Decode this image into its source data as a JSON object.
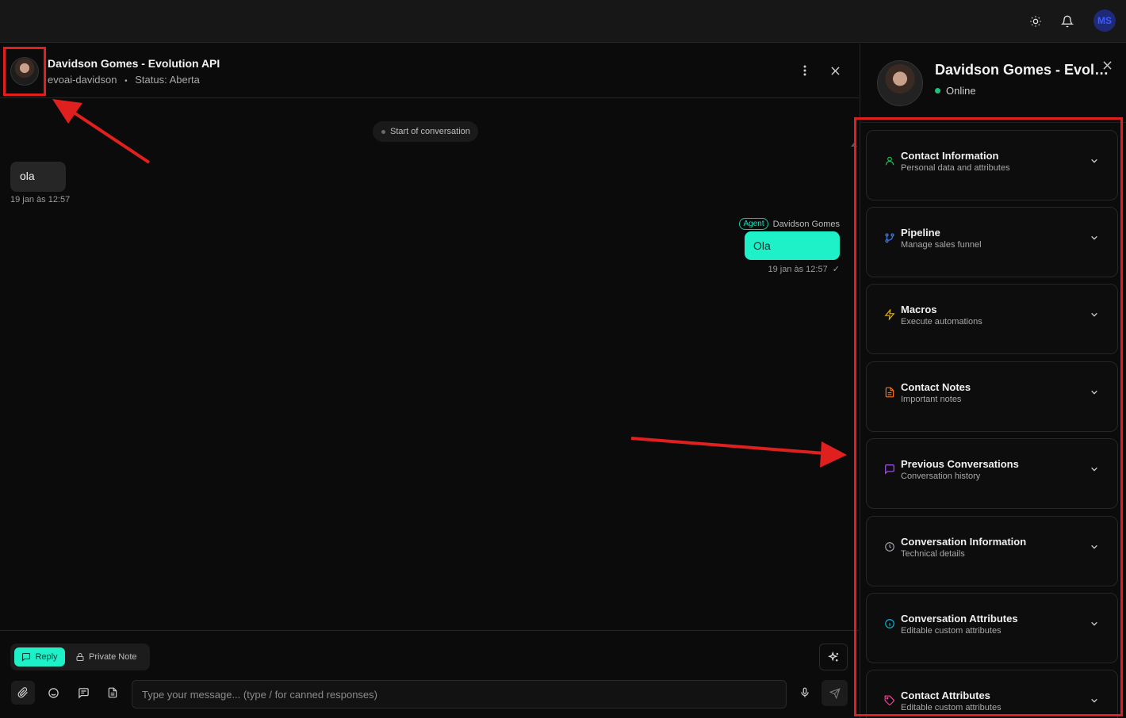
{
  "topbar": {
    "theme_icon": "sun-icon",
    "notifications_icon": "bell-icon",
    "user_initials": "MS"
  },
  "chat": {
    "contact_name": "Davidson Gomes - Evolution API",
    "inbox": "evoai-davidson",
    "separator": "•",
    "status": "Status: Aberta",
    "start_pill": "Start of conversation",
    "messages": [
      {
        "direction": "in",
        "text": "ola",
        "time": "19 jan às 12:57"
      },
      {
        "direction": "out",
        "tag": "Agent",
        "sender": "Davidson Gomes",
        "text": "Ola",
        "time": "19 jan às 12:57"
      }
    ]
  },
  "composer": {
    "reply_label": "Reply",
    "private_note_label": "Private Note",
    "placeholder": "Type your message... (type / for canned responses)"
  },
  "sidebar": {
    "name": "Davidson Gomes - Evolution API",
    "presence": "Online",
    "sections": [
      {
        "title": "Contact Information",
        "subtitle": "Personal data and attributes",
        "icon": "user-icon",
        "color": "#22c55e"
      },
      {
        "title": "Pipeline",
        "subtitle": "Manage sales funnel",
        "icon": "git-branch-icon",
        "color": "#3b82f6"
      },
      {
        "title": "Macros",
        "subtitle": "Execute automations",
        "icon": "zap-icon",
        "color": "#eab308"
      },
      {
        "title": "Contact Notes",
        "subtitle": "Important notes",
        "icon": "file-text-icon",
        "color": "#f97316"
      },
      {
        "title": "Previous Conversations",
        "subtitle": "Conversation history",
        "icon": "message-square-icon",
        "color": "#a855f7"
      },
      {
        "title": "Conversation Information",
        "subtitle": "Technical details",
        "icon": "clock-icon",
        "color": "#9ca3af"
      },
      {
        "title": "Conversation Attributes",
        "subtitle": "Editable custom attributes",
        "icon": "info-icon",
        "color": "#06b6d4"
      },
      {
        "title": "Contact Attributes",
        "subtitle": "Editable custom attributes",
        "icon": "tag-icon",
        "color": "#ec4899"
      }
    ]
  },
  "colors": {
    "accent": "#1ef0c8",
    "annotation": "#e01f1f",
    "background": "#0b0b0b"
  }
}
